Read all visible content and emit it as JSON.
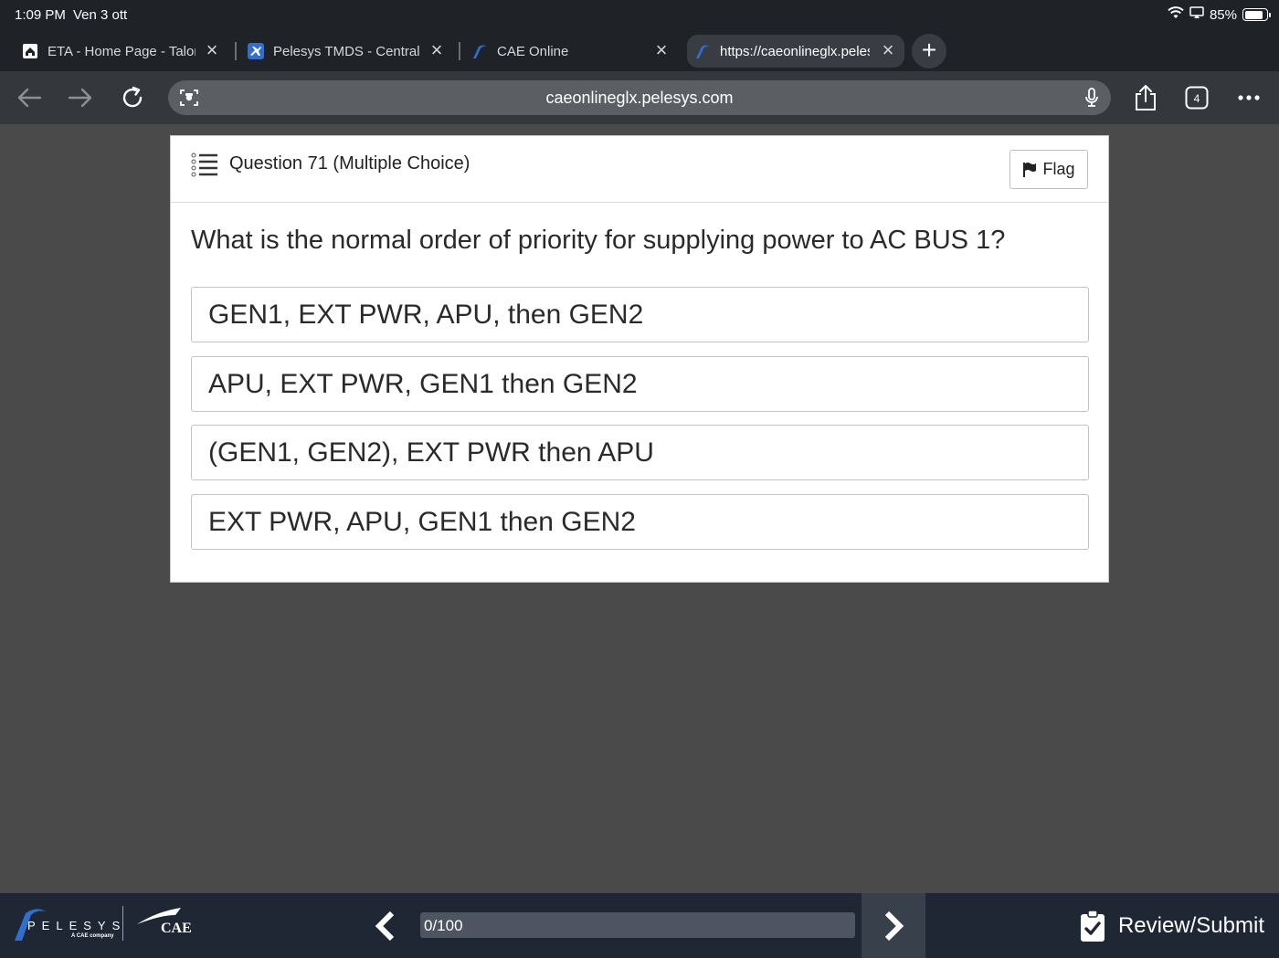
{
  "status_bar": {
    "time": "1:09 PM",
    "date": "Ven 3 ott",
    "battery": "85%",
    "battery_level": 0.85
  },
  "tabs": [
    {
      "title": "ETA - Home Page - Talon",
      "icon": "home-icon"
    },
    {
      "title": "Pelesys TMDS - Central",
      "icon": "plane-icon"
    },
    {
      "title": "CAE Online",
      "icon": "pelesys-icon"
    },
    {
      "title": "https://caeonlineglx.pelesys.com",
      "icon": "pelesys-icon",
      "active": true
    }
  ],
  "toolbar": {
    "url": "caeonlineglx.pelesys.com",
    "tab_count": "4"
  },
  "question": {
    "header": "Question 71 (Multiple Choice)",
    "flag_label": "Flag",
    "text": "What is the normal order of priority for supplying power to AC BUS 1?",
    "answers": [
      "GEN1, EXT PWR, APU, then GEN2",
      "APU, EXT PWR, GEN1 then GEN2",
      "(GEN1, GEN2), EXT PWR then APU",
      "EXT PWR, APU, GEN1 then GEN2"
    ]
  },
  "footer": {
    "pelesys_word": "PELESYS",
    "pelesys_sub": "A CAE company",
    "cae_word": "CAE",
    "progress_label": "0/100",
    "progress_fraction": 0,
    "review_label": "Review/Submit"
  },
  "colors": {
    "accent": "#3a8ee6",
    "footer_bg": "#1f2634",
    "page_bg": "#4a4a4b"
  }
}
